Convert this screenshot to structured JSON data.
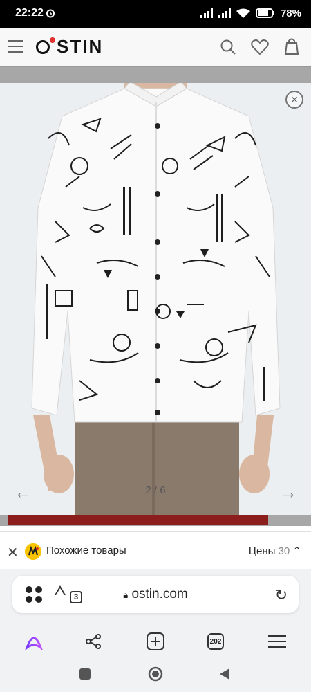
{
  "status": {
    "time": "22:22",
    "battery": "78"
  },
  "site": {
    "logo": "STIN",
    "icons": [
      "menu-icon",
      "search-icon",
      "heart-icon",
      "bag-icon"
    ]
  },
  "gallery": {
    "counter": "2 / 6",
    "prev": "←",
    "next": "→",
    "close": "×"
  },
  "similar": {
    "title": "Похожие товары",
    "prices_label": "Цены",
    "prices_count": "30"
  },
  "browser": {
    "url": "ostin.com",
    "tab_badge": "3",
    "tabs_count": "202"
  }
}
